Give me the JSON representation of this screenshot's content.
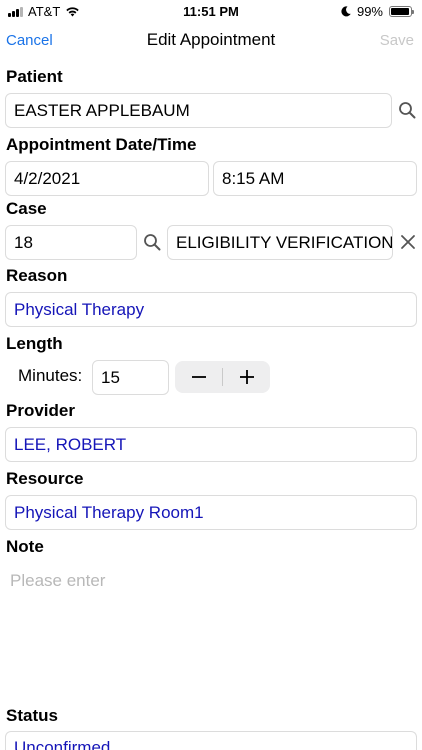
{
  "status_bar": {
    "carrier": "AT&T",
    "time": "11:51 PM",
    "battery": "99%"
  },
  "nav": {
    "cancel_label": "Cancel",
    "title": "Edit Appointment",
    "save_label": "Save"
  },
  "patient": {
    "label": "Patient",
    "value": "EASTER APPLEBAUM",
    "search_icon": "search-icon"
  },
  "appointment": {
    "label": "Appointment Date/Time",
    "date": "4/2/2021",
    "time": "8:15 AM"
  },
  "case": {
    "label": "Case",
    "number": "18",
    "description": "ELIGIBILITY VERIFICATION",
    "search_icon": "search-icon",
    "clear_icon": "close-icon"
  },
  "reason": {
    "label": "Reason",
    "value": "Physical Therapy"
  },
  "length": {
    "label": "Length",
    "minutes_label": "Minutes:",
    "minutes_value": "15",
    "decrement_icon": "minus-icon",
    "increment_icon": "plus-icon"
  },
  "provider": {
    "label": "Provider",
    "value": "LEE, ROBERT"
  },
  "resource": {
    "label": "Resource",
    "value": "Physical Therapy Room1"
  },
  "note": {
    "label": "Note",
    "placeholder": "Please enter"
  },
  "status": {
    "label": "Status",
    "value": "Unconfirmed"
  },
  "colors": {
    "link": "#1a73e8",
    "value_blue": "#1515b8",
    "disabled": "#c8c8c8"
  }
}
